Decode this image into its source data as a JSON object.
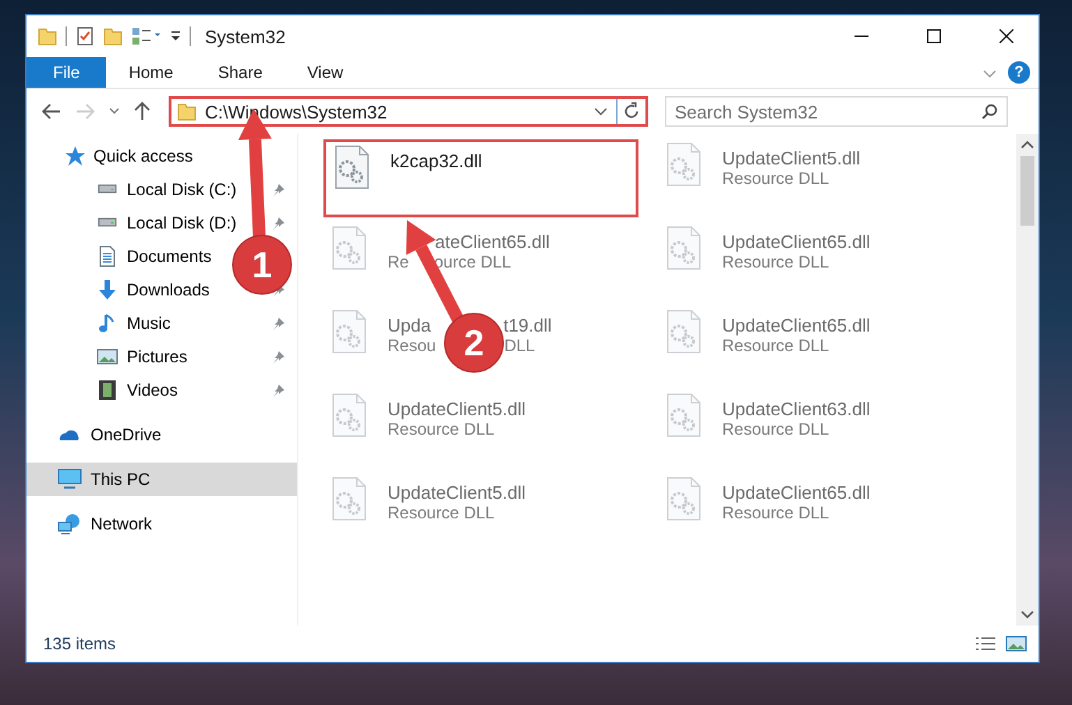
{
  "window": {
    "title": "System32"
  },
  "ribbon": {
    "tabs": [
      {
        "label": "File",
        "kind": "file",
        "selected": false
      },
      {
        "label": "Home",
        "kind": "tab",
        "selected": false
      },
      {
        "label": "Share",
        "kind": "tab",
        "selected": false
      },
      {
        "label": "View",
        "kind": "tab",
        "selected": false
      }
    ],
    "help": "?"
  },
  "address_bar": {
    "path": "C:\\Windows\\System32",
    "forward_disabled": true
  },
  "search": {
    "placeholder": "Search System32"
  },
  "sidebar": {
    "items": [
      {
        "label": "Quick access",
        "kind": "star",
        "selected": false,
        "pinned": false,
        "children": [
          {
            "label": "Local Disk (C:)",
            "kind": "disk",
            "selected": false,
            "pinned": true
          },
          {
            "label": "Local Disk (D:)",
            "kind": "disk",
            "selected": false,
            "pinned": true
          },
          {
            "label": "Documents",
            "kind": "document",
            "selected": false,
            "pinned": false
          },
          {
            "label": "Downloads",
            "kind": "download",
            "selected": false,
            "pinned": true
          },
          {
            "label": "Music",
            "kind": "music",
            "selected": false,
            "pinned": true
          },
          {
            "label": "Pictures",
            "kind": "picture",
            "selected": false,
            "pinned": true
          },
          {
            "label": "Videos",
            "kind": "video",
            "selected": false,
            "pinned": true
          }
        ]
      },
      {
        "label": "OneDrive",
        "kind": "cloud",
        "selected": false,
        "pinned": false
      },
      {
        "label": "This PC",
        "kind": "pc",
        "selected": true,
        "pinned": false
      },
      {
        "label": "Network",
        "kind": "network",
        "selected": false,
        "pinned": false
      }
    ]
  },
  "files": [
    {
      "name": "k2cap32.dll",
      "highlighted": true
    },
    {
      "name": "UpdateClient5.dll",
      "type": "Resource DLL",
      "highlighted": false
    },
    {
      "name": [
        "ateClient65.dll"
      ],
      "type": [
        "Re",
        "ource DLL"
      ],
      "highlighted": false
    },
    {
      "name": "UpdateClient65.dll",
      "type": "Resource DLL",
      "highlighted": false
    },
    {
      "name": [
        "Upda",
        "t19.dll"
      ],
      "type": [
        "Resou",
        "DLL"
      ],
      "highlighted": false
    },
    {
      "name": "UpdateClient65.dll",
      "type": "Resource DLL",
      "highlighted": false
    },
    {
      "name": "UpdateClient5.dll",
      "type": "Resource DLL",
      "highlighted": false
    },
    {
      "name": "UpdateClient63.dll",
      "type": "Resource DLL",
      "highlighted": false
    },
    {
      "name": "UpdateClient5.dll",
      "type": "Resource DLL",
      "highlighted": false
    },
    {
      "name": "UpdateClient65.dll",
      "type": "Resource DLL",
      "highlighted": false
    }
  ],
  "status_bar": {
    "item_count": "135 items"
  },
  "callouts": [
    {
      "number": "1"
    },
    {
      "number": "2"
    }
  ]
}
